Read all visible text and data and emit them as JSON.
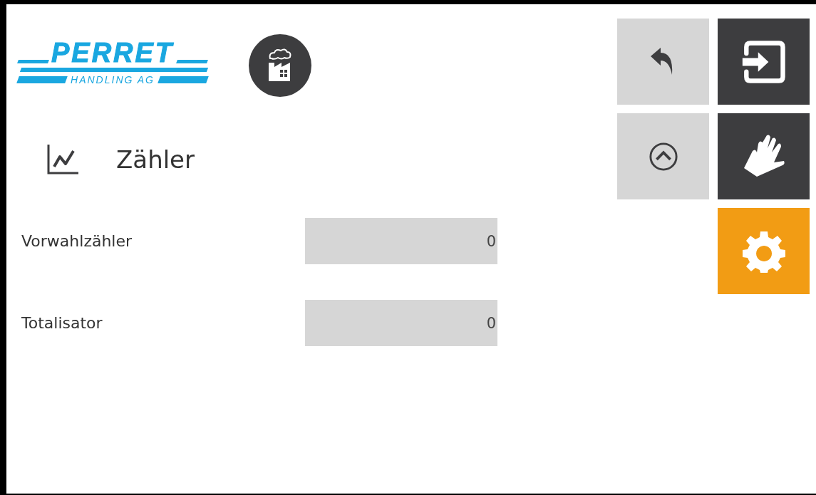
{
  "logo": {
    "name": "PERRET",
    "subtitle": "HANDLING AG"
  },
  "title": "Zähler",
  "fields": [
    {
      "label": "Vorwahlzähler",
      "value": "0"
    },
    {
      "label": "Totalisator",
      "value": "0"
    }
  ],
  "buttons": [
    {
      "kind": "light"
    },
    {
      "kind": "dark"
    },
    {
      "kind": "light"
    },
    {
      "kind": "dark"
    },
    {
      "kind": "empty"
    },
    {
      "kind": "accent"
    }
  ]
}
